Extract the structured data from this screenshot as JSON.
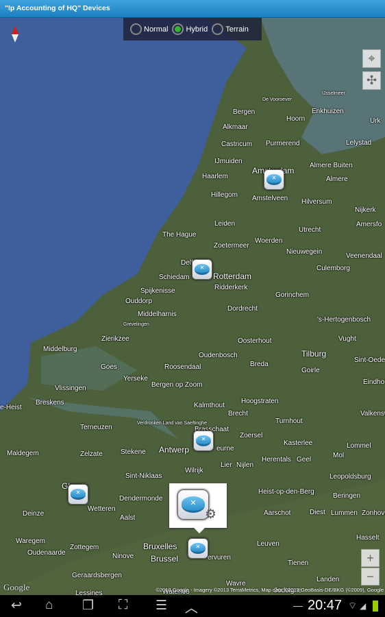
{
  "title": "\"Ip Accounting of HQ\" Devices",
  "map_modes": [
    {
      "label": "Normal",
      "selected": false
    },
    {
      "label": "Hybrid",
      "selected": true
    },
    {
      "label": "Terrain",
      "selected": false
    }
  ],
  "places": [
    "De Vooroever",
    "IJsselmeer",
    "Bergen",
    "Hoorn",
    "Enkhuizen",
    "Urk",
    "Alkmaar",
    "Castricum",
    "Purmerend",
    "Lelystad",
    "IJmuiden",
    "Amsterdam",
    "Almere Buiten",
    "Haarlem",
    "Almere",
    "Hillegom",
    "Amstelveen",
    "Hilversum",
    "Nijkerk",
    "Leiden",
    "Amersfo",
    "Utrecht",
    "The Hague",
    "Zoetermeer",
    "Woerden",
    "Nieuwegein",
    "Veenendaal",
    "Delft",
    "Schiedam",
    "Rotterdam",
    "Culemborg",
    "Spijkenisse",
    "Ridderkerk",
    "Ouddorp",
    "Gorinchem",
    "Middelharnis",
    "Grevelingen",
    "Dordrecht",
    "'s-Hertogenbosch",
    "Zierikzee",
    "Oosterhout",
    "Vught",
    "Middelburg",
    "Goes",
    "Roosendaal",
    "Oudenbosch",
    "Breda",
    "Tilburg",
    "Goirle",
    "Sint-Oede",
    "Yerseke",
    "Bergen op Zoom",
    "Vlissingen",
    "Eindho",
    "Breskens",
    "Hoogstraten",
    "Kalmthout",
    "e-Heist",
    "Brecht",
    "Valkensw",
    "Verdronken Land van Saeftinghe",
    "Terneuzen",
    "Brasschaat",
    "Zoersel",
    "Turnhout",
    "Kasterlee",
    "Lommel",
    "Maldegem",
    "Zelzate",
    "Stekene",
    "Antwerp",
    "eurne",
    "Lier",
    "Nijlen",
    "Herentals",
    "Geel",
    "Mol",
    "Sint-Niklaas",
    "Wilrijk",
    "Leopoldsburg",
    "Ghent",
    "Heist-op-den-Berg",
    "Beringen",
    "Dendermonde",
    "Wetteren",
    "Aalst",
    "Aarschot",
    "Diest",
    "Lummen",
    "Zonhove",
    "Deinze",
    "Hasselt",
    "Waregem",
    "Zottegem",
    "Oudenaarde",
    "Ninove",
    "Bruxelles",
    "Brussel",
    "ervuren",
    "Leuven",
    "Tienen",
    "Geraardsbergen",
    "Landen",
    "Wavre",
    "Lessines",
    "Waterloo",
    "Jodoigne"
  ],
  "devices": [
    {
      "icon": "router-icon"
    },
    {
      "icon": "router-icon"
    },
    {
      "icon": "router-icon"
    },
    {
      "icon": "router-icon"
    },
    {
      "icon": "router-icon"
    }
  ],
  "callout": {
    "icon": "router-icon",
    "settings_icon": "gear-icon"
  },
  "controls": {
    "my_location": "⌖",
    "compass": "✣",
    "zoom_in": "+",
    "zoom_out": "−"
  },
  "attribution": "©2013 Google - Imagery ©2013 TerraMetrics, Map data ©2013 GeoBasis-DE/BKG (©2009), Google",
  "google_logo": "Google",
  "status": {
    "time": "20:47"
  },
  "colors": {
    "titlebar": "#2a8fd0",
    "selected_radio": "#2db82d",
    "sea": "#3f5f9c",
    "land": "#4a5f3a"
  }
}
